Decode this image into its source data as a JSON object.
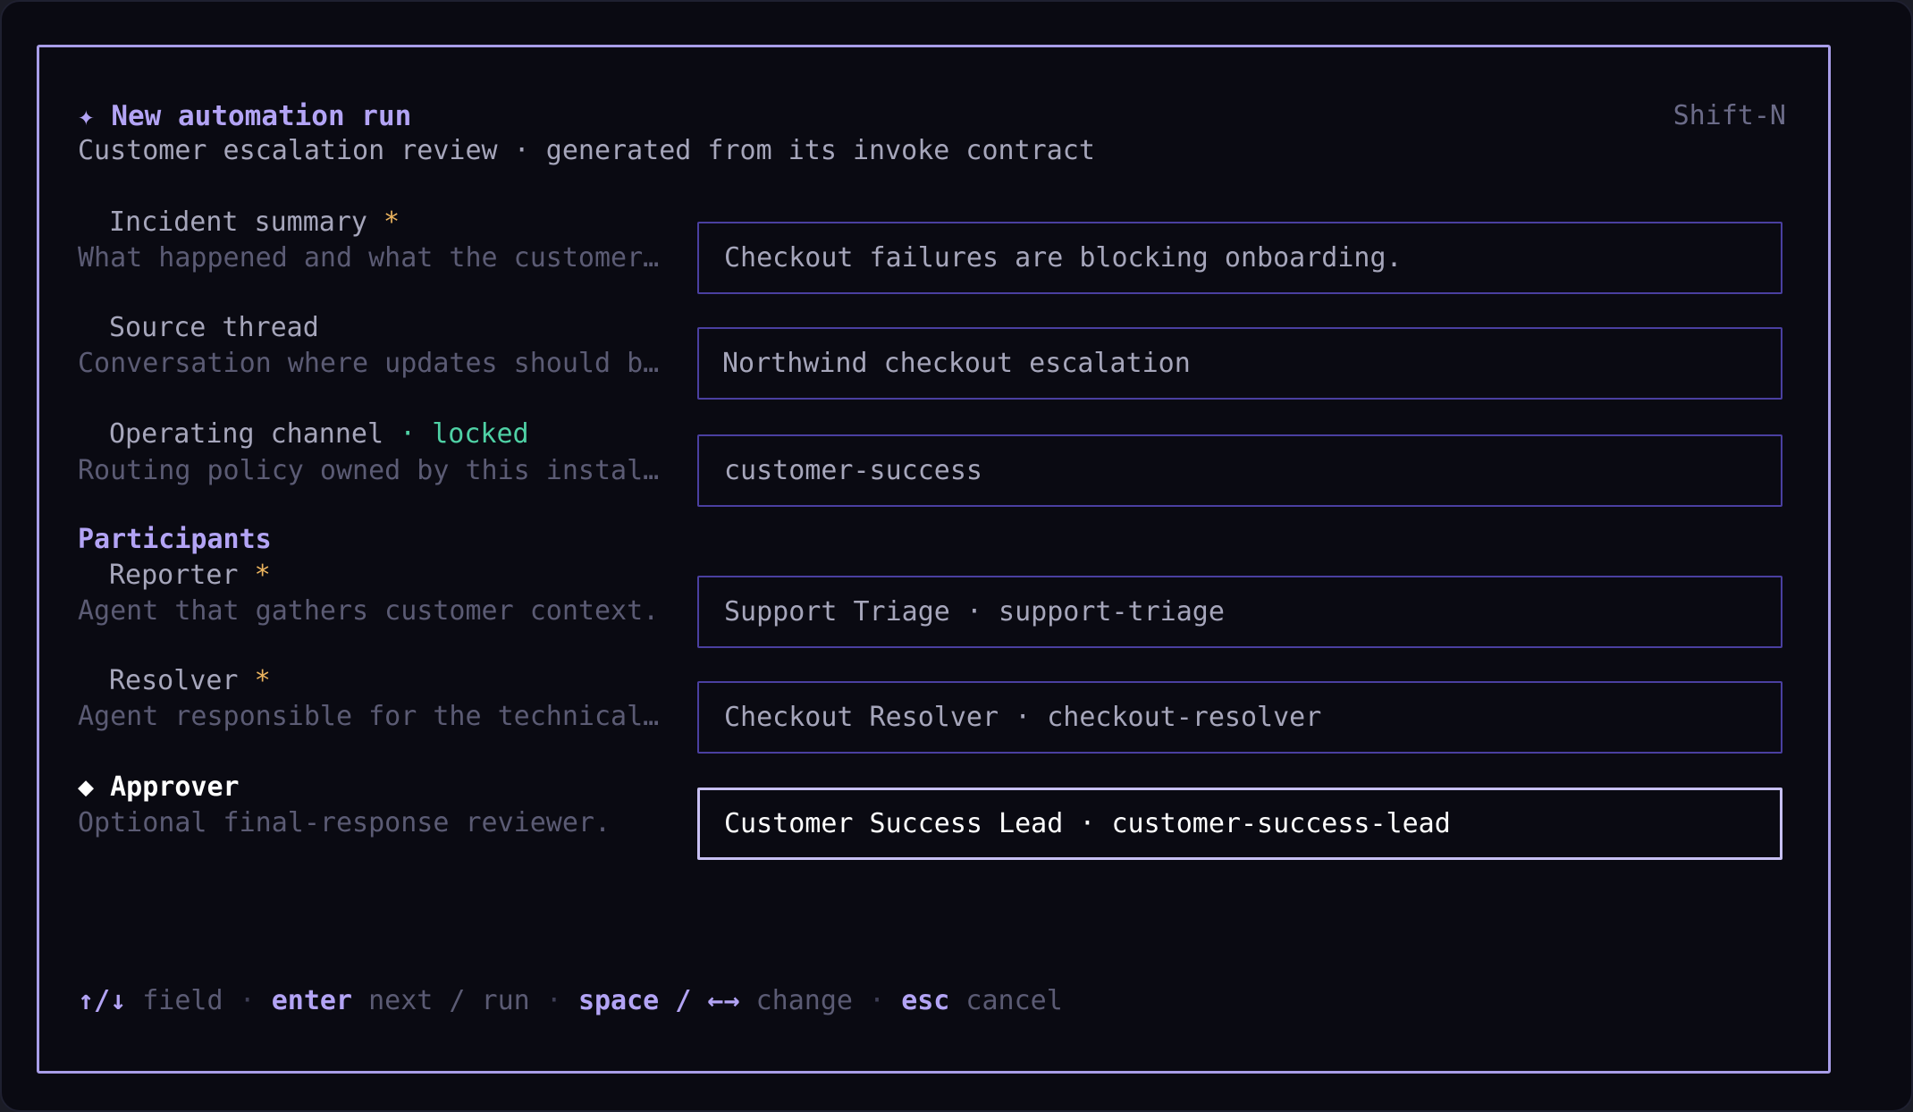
{
  "header": {
    "icon": "sparkle-icon",
    "icon_glyph": "✦",
    "title": "New automation run",
    "shortcut": "Shift-N",
    "subtitle": "Customer escalation review · generated from its invoke contract"
  },
  "fields": [
    {
      "label": "Incident summary",
      "required_mark": "*",
      "description": "What happened and what the customer…",
      "value": "Checkout failures are blocking onboarding."
    },
    {
      "label": "Source thread",
      "description": "Conversation where updates should b…",
      "value": "Northwind checkout escalation"
    },
    {
      "label": "Operating channel",
      "status": "· locked",
      "description": "Routing policy owned by this instal…",
      "value": "customer-success"
    }
  ],
  "participants": {
    "heading": "Participants",
    "items": [
      {
        "label": "Reporter",
        "required_mark": "*",
        "description": "Agent that gathers customer context.",
        "value": "Support Triage · support-triage"
      },
      {
        "label": "Resolver",
        "required_mark": "*",
        "description": "Agent responsible for the technical…",
        "value": "Checkout Resolver · checkout-resolver"
      },
      {
        "label": "Approver",
        "marker": "◆",
        "description": "Optional final-response reviewer.",
        "value": "Customer Success Lead · customer-success-lead"
      }
    ]
  },
  "footer": {
    "k1": "↑/↓",
    "d1": " field",
    "sep": " · ",
    "k2": "enter",
    "d2": " next / run",
    "k3": "space / ←→",
    "d3": " change",
    "k4": "esc",
    "d4": " cancel"
  },
  "colors": {
    "accent": "#b3a4f5",
    "required": "#ecb45e",
    "locked": "#4fd1a5",
    "field_border": "#4a3fa0",
    "panel_border": "#a89de8",
    "background": "#0a0a12"
  }
}
